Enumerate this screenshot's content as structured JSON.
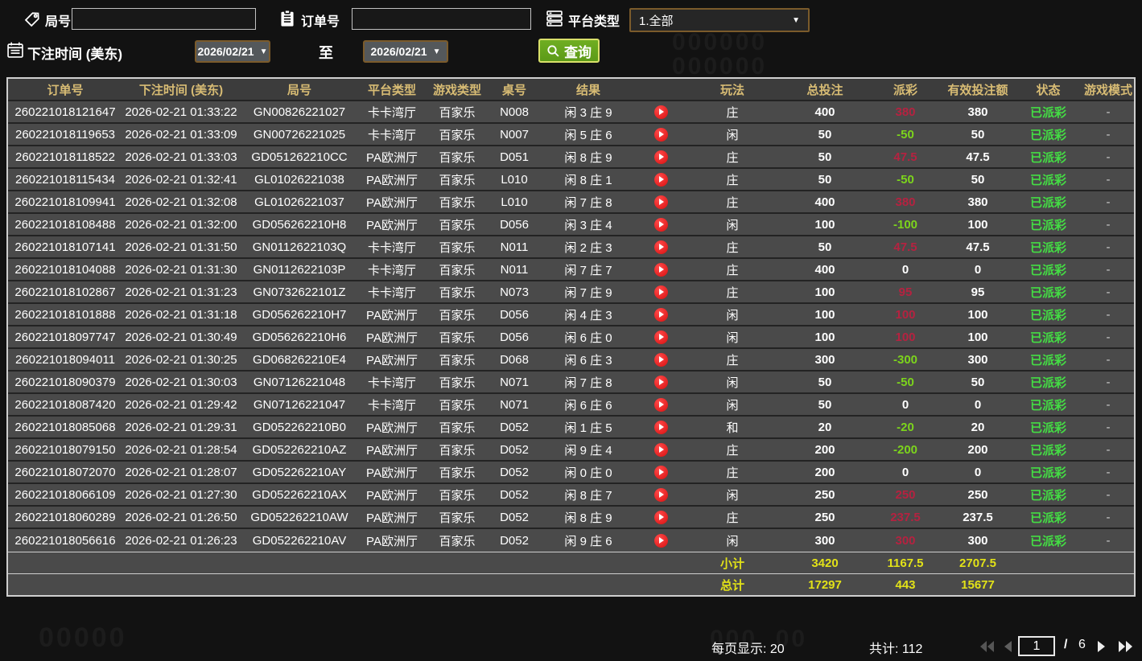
{
  "filters": {
    "round_label": "局号",
    "order_label": "订单号",
    "platform_label": "平台类型",
    "platform_value": "1.全部",
    "bet_time_label": "下注时间 (美东)",
    "date_from": "2026/02/21",
    "to_label": "至",
    "date_to": "2026/02/21",
    "search_label": "查询",
    "round_value": "",
    "order_value": ""
  },
  "icons": {
    "caret_down": "▼"
  },
  "background": {
    "watermark_a": "000000\n000000",
    "watermark_b": "00000",
    "watermark_c": "000  00"
  },
  "colors": {
    "header_gold": "#d8bc74",
    "payout_win_red": "#b52240",
    "payout_loss_green": "#7cd41c",
    "status_green": "#44dd44",
    "summary_yellow": "#e2e218",
    "search_button_green": "#5c9a18",
    "play_button_red": "#d80f0f",
    "row_bg": "#4a4a4a",
    "header_bg": "#3c3c3c"
  },
  "table": {
    "headers": [
      "订单号",
      "下注时间 (美东)",
      "局号",
      "平台类型",
      "游戏类型",
      "桌号",
      "结果",
      "",
      "玩法",
      "总投注",
      "派彩",
      "有效投注额",
      "状态",
      "游戏模式"
    ],
    "rows": [
      {
        "order_id": "260221018121647",
        "bet_time": "2026-02-21 01:33:22",
        "round_no": "GN00826221027",
        "platform": "卡卡湾厅",
        "game_type": "百家乐",
        "table_no": "N008",
        "result": "闲 3 庄 9",
        "play_type": "庄",
        "total_bet": "400",
        "payout": "380",
        "payout_color": "red",
        "valid_bet": "380",
        "status": "已派彩",
        "mode": "-"
      },
      {
        "order_id": "260221018119653",
        "bet_time": "2026-02-21 01:33:09",
        "round_no": "GN00726221025",
        "platform": "卡卡湾厅",
        "game_type": "百家乐",
        "table_no": "N007",
        "result": "闲 5 庄 6",
        "play_type": "闲",
        "total_bet": "50",
        "payout": "-50",
        "payout_color": "green",
        "valid_bet": "50",
        "status": "已派彩",
        "mode": "-"
      },
      {
        "order_id": "260221018118522",
        "bet_time": "2026-02-21 01:33:03",
        "round_no": "GD051262210CC",
        "platform": "PA欧洲厅",
        "game_type": "百家乐",
        "table_no": "D051",
        "result": "闲 8 庄 9",
        "play_type": "庄",
        "total_bet": "50",
        "payout": "47.5",
        "payout_color": "red",
        "valid_bet": "47.5",
        "status": "已派彩",
        "mode": "-"
      },
      {
        "order_id": "260221018115434",
        "bet_time": "2026-02-21 01:32:41",
        "round_no": "GL01026221038",
        "platform": "PA欧洲厅",
        "game_type": "百家乐",
        "table_no": "L010",
        "result": "闲 8 庄 1",
        "play_type": "庄",
        "total_bet": "50",
        "payout": "-50",
        "payout_color": "green",
        "valid_bet": "50",
        "status": "已派彩",
        "mode": "-"
      },
      {
        "order_id": "260221018109941",
        "bet_time": "2026-02-21 01:32:08",
        "round_no": "GL01026221037",
        "platform": "PA欧洲厅",
        "game_type": "百家乐",
        "table_no": "L010",
        "result": "闲 7 庄 8",
        "play_type": "庄",
        "total_bet": "400",
        "payout": "380",
        "payout_color": "red",
        "valid_bet": "380",
        "status": "已派彩",
        "mode": "-"
      },
      {
        "order_id": "260221018108488",
        "bet_time": "2026-02-21 01:32:00",
        "round_no": "GD056262210H8",
        "platform": "PA欧洲厅",
        "game_type": "百家乐",
        "table_no": "D056",
        "result": "闲 3 庄 4",
        "play_type": "闲",
        "total_bet": "100",
        "payout": "-100",
        "payout_color": "green",
        "valid_bet": "100",
        "status": "已派彩",
        "mode": "-"
      },
      {
        "order_id": "260221018107141",
        "bet_time": "2026-02-21 01:31:50",
        "round_no": "GN0112622103Q",
        "platform": "卡卡湾厅",
        "game_type": "百家乐",
        "table_no": "N011",
        "result": "闲 2 庄 3",
        "play_type": "庄",
        "total_bet": "50",
        "payout": "47.5",
        "payout_color": "red",
        "valid_bet": "47.5",
        "status": "已派彩",
        "mode": "-"
      },
      {
        "order_id": "260221018104088",
        "bet_time": "2026-02-21 01:31:30",
        "round_no": "GN0112622103P",
        "platform": "卡卡湾厅",
        "game_type": "百家乐",
        "table_no": "N011",
        "result": "闲 7 庄 7",
        "play_type": "庄",
        "total_bet": "400",
        "payout": "0",
        "payout_color": "white",
        "valid_bet": "0",
        "status": "已派彩",
        "mode": "-"
      },
      {
        "order_id": "260221018102867",
        "bet_time": "2026-02-21 01:31:23",
        "round_no": "GN0732622101Z",
        "platform": "卡卡湾厅",
        "game_type": "百家乐",
        "table_no": "N073",
        "result": "闲 7 庄 9",
        "play_type": "庄",
        "total_bet": "100",
        "payout": "95",
        "payout_color": "red",
        "valid_bet": "95",
        "status": "已派彩",
        "mode": "-"
      },
      {
        "order_id": "260221018101888",
        "bet_time": "2026-02-21 01:31:18",
        "round_no": "GD056262210H7",
        "platform": "PA欧洲厅",
        "game_type": "百家乐",
        "table_no": "D056",
        "result": "闲 4 庄 3",
        "play_type": "闲",
        "total_bet": "100",
        "payout": "100",
        "payout_color": "red",
        "valid_bet": "100",
        "status": "已派彩",
        "mode": "-"
      },
      {
        "order_id": "260221018097747",
        "bet_time": "2026-02-21 01:30:49",
        "round_no": "GD056262210H6",
        "platform": "PA欧洲厅",
        "game_type": "百家乐",
        "table_no": "D056",
        "result": "闲 6 庄 0",
        "play_type": "闲",
        "total_bet": "100",
        "payout": "100",
        "payout_color": "red",
        "valid_bet": "100",
        "status": "已派彩",
        "mode": "-"
      },
      {
        "order_id": "260221018094011",
        "bet_time": "2026-02-21 01:30:25",
        "round_no": "GD068262210E4",
        "platform": "PA欧洲厅",
        "game_type": "百家乐",
        "table_no": "D068",
        "result": "闲 6 庄 3",
        "play_type": "庄",
        "total_bet": "300",
        "payout": "-300",
        "payout_color": "green",
        "valid_bet": "300",
        "status": "已派彩",
        "mode": "-"
      },
      {
        "order_id": "260221018090379",
        "bet_time": "2026-02-21 01:30:03",
        "round_no": "GN07126221048",
        "platform": "卡卡湾厅",
        "game_type": "百家乐",
        "table_no": "N071",
        "result": "闲 7 庄 8",
        "play_type": "闲",
        "total_bet": "50",
        "payout": "-50",
        "payout_color": "green",
        "valid_bet": "50",
        "status": "已派彩",
        "mode": "-"
      },
      {
        "order_id": "260221018087420",
        "bet_time": "2026-02-21 01:29:42",
        "round_no": "GN07126221047",
        "platform": "卡卡湾厅",
        "game_type": "百家乐",
        "table_no": "N071",
        "result": "闲 6 庄 6",
        "play_type": "闲",
        "total_bet": "50",
        "payout": "0",
        "payout_color": "white",
        "valid_bet": "0",
        "status": "已派彩",
        "mode": "-"
      },
      {
        "order_id": "260221018085068",
        "bet_time": "2026-02-21 01:29:31",
        "round_no": "GD052262210B0",
        "platform": "PA欧洲厅",
        "game_type": "百家乐",
        "table_no": "D052",
        "result": "闲 1 庄 5",
        "play_type": "和",
        "total_bet": "20",
        "payout": "-20",
        "payout_color": "green",
        "valid_bet": "20",
        "status": "已派彩",
        "mode": "-"
      },
      {
        "order_id": "260221018079150",
        "bet_time": "2026-02-21 01:28:54",
        "round_no": "GD052262210AZ",
        "platform": "PA欧洲厅",
        "game_type": "百家乐",
        "table_no": "D052",
        "result": "闲 9 庄 4",
        "play_type": "庄",
        "total_bet": "200",
        "payout": "-200",
        "payout_color": "green",
        "valid_bet": "200",
        "status": "已派彩",
        "mode": "-"
      },
      {
        "order_id": "260221018072070",
        "bet_time": "2026-02-21 01:28:07",
        "round_no": "GD052262210AY",
        "platform": "PA欧洲厅",
        "game_type": "百家乐",
        "table_no": "D052",
        "result": "闲 0 庄 0",
        "play_type": "庄",
        "total_bet": "200",
        "payout": "0",
        "payout_color": "white",
        "valid_bet": "0",
        "status": "已派彩",
        "mode": "-"
      },
      {
        "order_id": "260221018066109",
        "bet_time": "2026-02-21 01:27:30",
        "round_no": "GD052262210AX",
        "platform": "PA欧洲厅",
        "game_type": "百家乐",
        "table_no": "D052",
        "result": "闲 8 庄 7",
        "play_type": "闲",
        "total_bet": "250",
        "payout": "250",
        "payout_color": "red",
        "valid_bet": "250",
        "status": "已派彩",
        "mode": "-"
      },
      {
        "order_id": "260221018060289",
        "bet_time": "2026-02-21 01:26:50",
        "round_no": "GD052262210AW",
        "platform": "PA欧洲厅",
        "game_type": "百家乐",
        "table_no": "D052",
        "result": "闲 8 庄 9",
        "play_type": "庄",
        "total_bet": "250",
        "payout": "237.5",
        "payout_color": "red",
        "valid_bet": "237.5",
        "status": "已派彩",
        "mode": "-"
      },
      {
        "order_id": "260221018056616",
        "bet_time": "2026-02-21 01:26:23",
        "round_no": "GD052262210AV",
        "platform": "PA欧洲厅",
        "game_type": "百家乐",
        "table_no": "D052",
        "result": "闲 9 庄 6",
        "play_type": "闲",
        "total_bet": "300",
        "payout": "300",
        "payout_color": "red",
        "valid_bet": "300",
        "status": "已派彩",
        "mode": "-"
      }
    ],
    "subtotal": {
      "label": "小计",
      "total_bet": "3420",
      "payout": "1167.5",
      "valid_bet": "2707.5"
    },
    "total": {
      "label": "总计",
      "total_bet": "17297",
      "payout": "443",
      "valid_bet": "15677"
    }
  },
  "footer": {
    "per_page_label": "每页显示: 20",
    "total_count_label": "共计: 112",
    "page_value": "1",
    "page_sep": "/",
    "page_total": "6"
  }
}
